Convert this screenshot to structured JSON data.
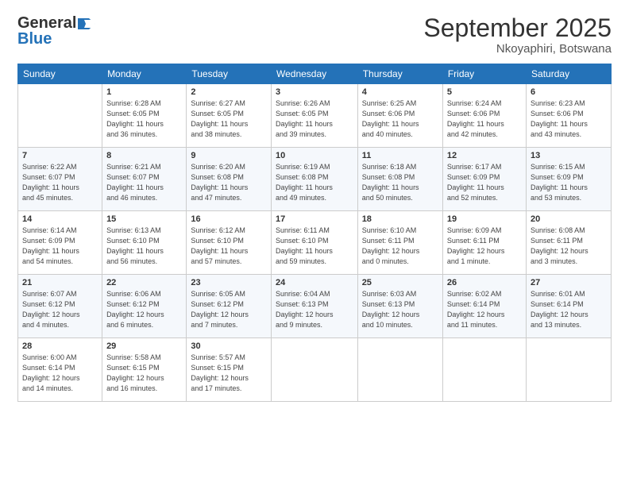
{
  "logo": {
    "line1": "General",
    "line2": "Blue"
  },
  "title": "September 2025",
  "location": "Nkoyaphiri, Botswana",
  "headers": [
    "Sunday",
    "Monday",
    "Tuesday",
    "Wednesday",
    "Thursday",
    "Friday",
    "Saturday"
  ],
  "weeks": [
    [
      {
        "day": "",
        "info": ""
      },
      {
        "day": "1",
        "info": "Sunrise: 6:28 AM\nSunset: 6:05 PM\nDaylight: 11 hours\nand 36 minutes."
      },
      {
        "day": "2",
        "info": "Sunrise: 6:27 AM\nSunset: 6:05 PM\nDaylight: 11 hours\nand 38 minutes."
      },
      {
        "day": "3",
        "info": "Sunrise: 6:26 AM\nSunset: 6:05 PM\nDaylight: 11 hours\nand 39 minutes."
      },
      {
        "day": "4",
        "info": "Sunrise: 6:25 AM\nSunset: 6:06 PM\nDaylight: 11 hours\nand 40 minutes."
      },
      {
        "day": "5",
        "info": "Sunrise: 6:24 AM\nSunset: 6:06 PM\nDaylight: 11 hours\nand 42 minutes."
      },
      {
        "day": "6",
        "info": "Sunrise: 6:23 AM\nSunset: 6:06 PM\nDaylight: 11 hours\nand 43 minutes."
      }
    ],
    [
      {
        "day": "7",
        "info": "Sunrise: 6:22 AM\nSunset: 6:07 PM\nDaylight: 11 hours\nand 45 minutes."
      },
      {
        "day": "8",
        "info": "Sunrise: 6:21 AM\nSunset: 6:07 PM\nDaylight: 11 hours\nand 46 minutes."
      },
      {
        "day": "9",
        "info": "Sunrise: 6:20 AM\nSunset: 6:08 PM\nDaylight: 11 hours\nand 47 minutes."
      },
      {
        "day": "10",
        "info": "Sunrise: 6:19 AM\nSunset: 6:08 PM\nDaylight: 11 hours\nand 49 minutes."
      },
      {
        "day": "11",
        "info": "Sunrise: 6:18 AM\nSunset: 6:08 PM\nDaylight: 11 hours\nand 50 minutes."
      },
      {
        "day": "12",
        "info": "Sunrise: 6:17 AM\nSunset: 6:09 PM\nDaylight: 11 hours\nand 52 minutes."
      },
      {
        "day": "13",
        "info": "Sunrise: 6:15 AM\nSunset: 6:09 PM\nDaylight: 11 hours\nand 53 minutes."
      }
    ],
    [
      {
        "day": "14",
        "info": "Sunrise: 6:14 AM\nSunset: 6:09 PM\nDaylight: 11 hours\nand 54 minutes."
      },
      {
        "day": "15",
        "info": "Sunrise: 6:13 AM\nSunset: 6:10 PM\nDaylight: 11 hours\nand 56 minutes."
      },
      {
        "day": "16",
        "info": "Sunrise: 6:12 AM\nSunset: 6:10 PM\nDaylight: 11 hours\nand 57 minutes."
      },
      {
        "day": "17",
        "info": "Sunrise: 6:11 AM\nSunset: 6:10 PM\nDaylight: 11 hours\nand 59 minutes."
      },
      {
        "day": "18",
        "info": "Sunrise: 6:10 AM\nSunset: 6:11 PM\nDaylight: 12 hours\nand 0 minutes."
      },
      {
        "day": "19",
        "info": "Sunrise: 6:09 AM\nSunset: 6:11 PM\nDaylight: 12 hours\nand 1 minute."
      },
      {
        "day": "20",
        "info": "Sunrise: 6:08 AM\nSunset: 6:11 PM\nDaylight: 12 hours\nand 3 minutes."
      }
    ],
    [
      {
        "day": "21",
        "info": "Sunrise: 6:07 AM\nSunset: 6:12 PM\nDaylight: 12 hours\nand 4 minutes."
      },
      {
        "day": "22",
        "info": "Sunrise: 6:06 AM\nSunset: 6:12 PM\nDaylight: 12 hours\nand 6 minutes."
      },
      {
        "day": "23",
        "info": "Sunrise: 6:05 AM\nSunset: 6:12 PM\nDaylight: 12 hours\nand 7 minutes."
      },
      {
        "day": "24",
        "info": "Sunrise: 6:04 AM\nSunset: 6:13 PM\nDaylight: 12 hours\nand 9 minutes."
      },
      {
        "day": "25",
        "info": "Sunrise: 6:03 AM\nSunset: 6:13 PM\nDaylight: 12 hours\nand 10 minutes."
      },
      {
        "day": "26",
        "info": "Sunrise: 6:02 AM\nSunset: 6:14 PM\nDaylight: 12 hours\nand 11 minutes."
      },
      {
        "day": "27",
        "info": "Sunrise: 6:01 AM\nSunset: 6:14 PM\nDaylight: 12 hours\nand 13 minutes."
      }
    ],
    [
      {
        "day": "28",
        "info": "Sunrise: 6:00 AM\nSunset: 6:14 PM\nDaylight: 12 hours\nand 14 minutes."
      },
      {
        "day": "29",
        "info": "Sunrise: 5:58 AM\nSunset: 6:15 PM\nDaylight: 12 hours\nand 16 minutes."
      },
      {
        "day": "30",
        "info": "Sunrise: 5:57 AM\nSunset: 6:15 PM\nDaylight: 12 hours\nand 17 minutes."
      },
      {
        "day": "",
        "info": ""
      },
      {
        "day": "",
        "info": ""
      },
      {
        "day": "",
        "info": ""
      },
      {
        "day": "",
        "info": ""
      }
    ]
  ]
}
